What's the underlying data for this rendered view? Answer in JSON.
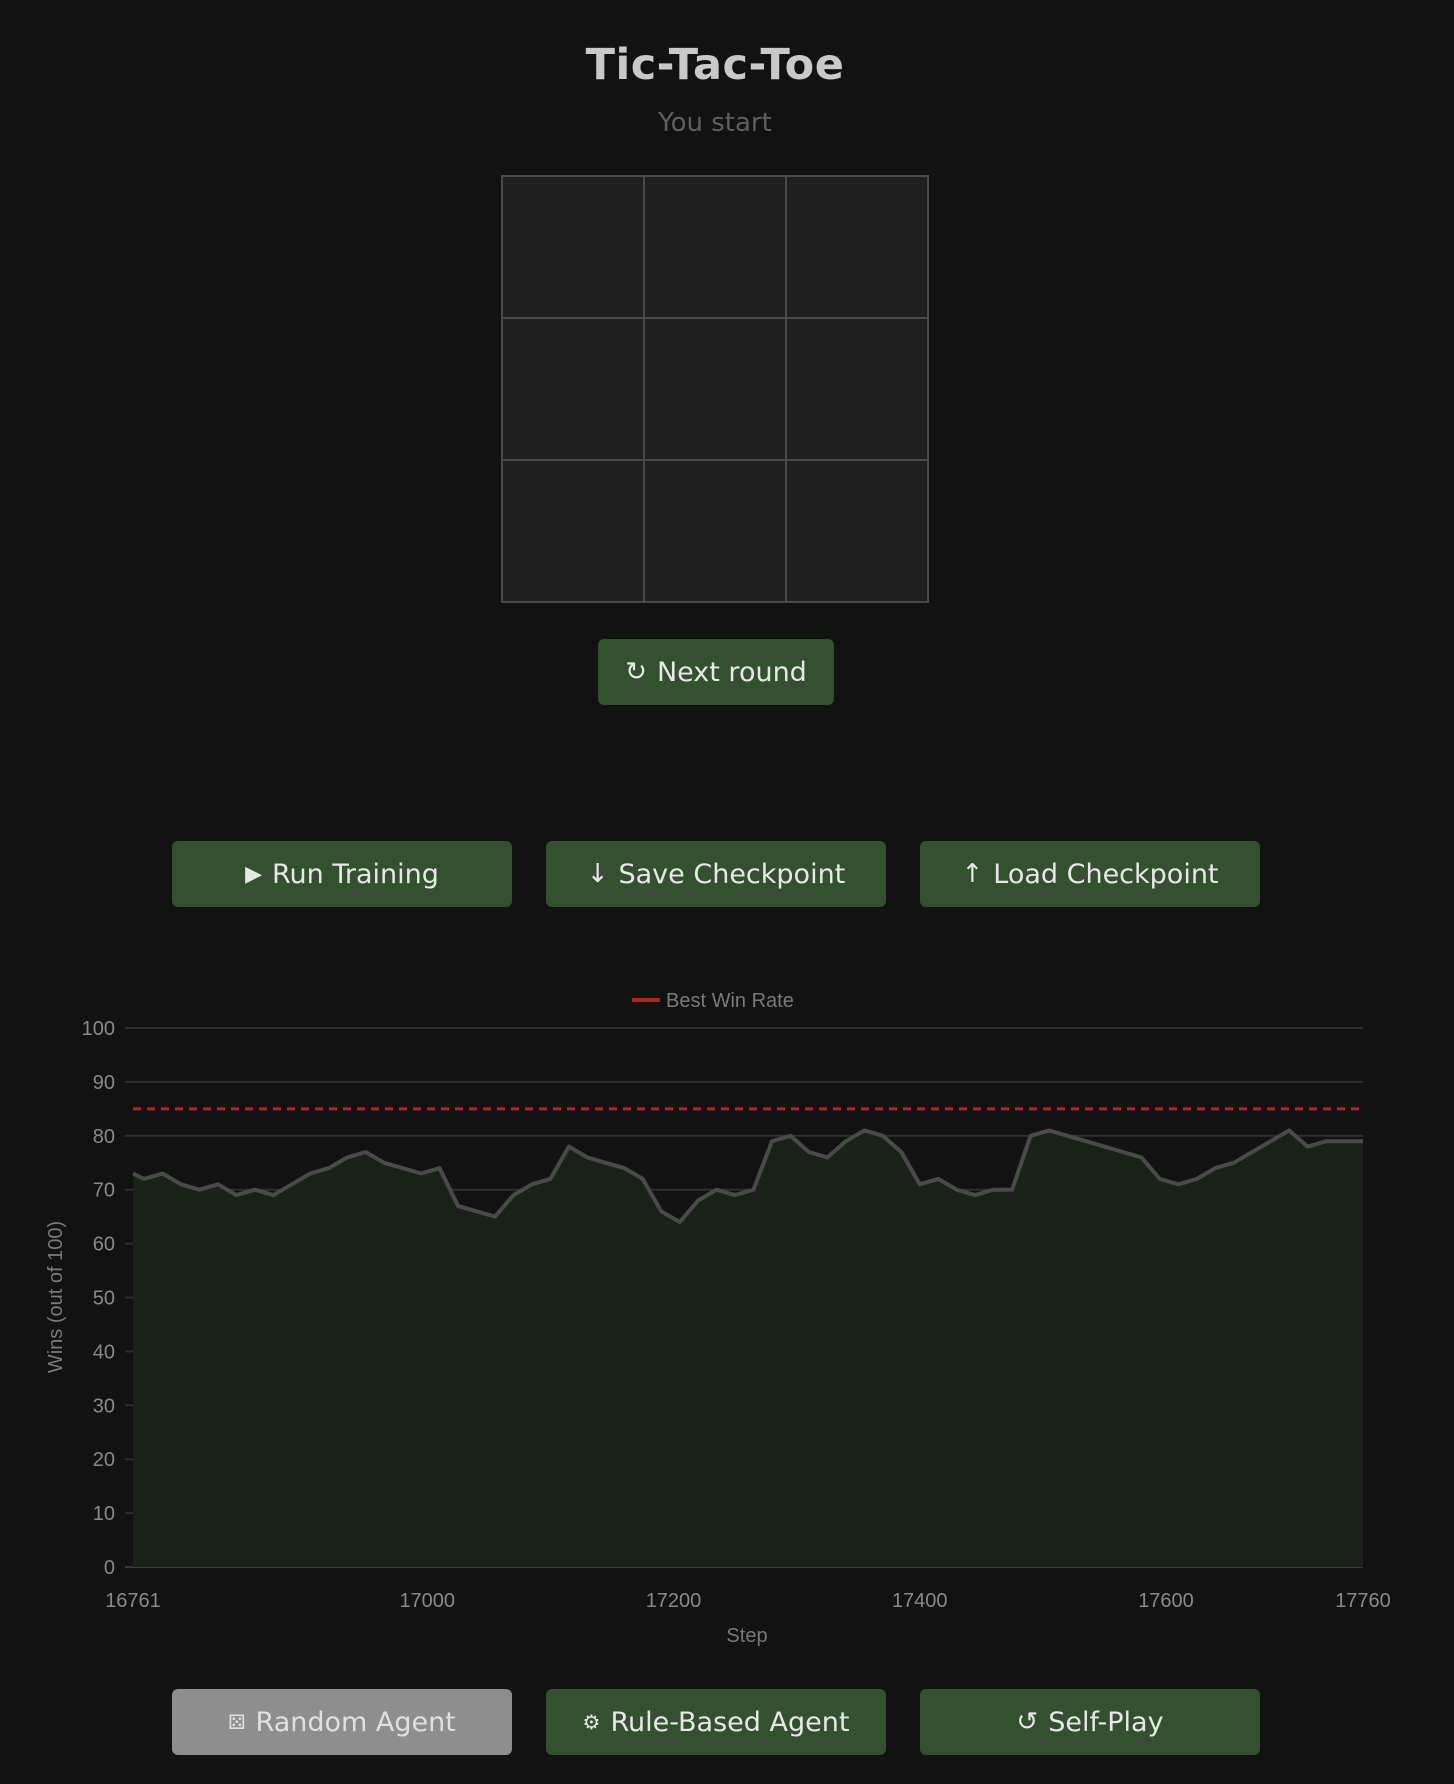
{
  "header": {
    "title": "Tic-Tac-Toe",
    "status": "You start"
  },
  "board": {
    "cells": [
      "",
      "",
      "",
      "",
      "",
      "",
      "",
      "",
      ""
    ]
  },
  "game_controls": {
    "next_round_label": "Next round",
    "next_round_icon": "refresh-icon"
  },
  "training_controls": {
    "run_training_label": "Run Training",
    "run_training_icon": "play-icon",
    "save_checkpoint_label": "Save Checkpoint",
    "save_checkpoint_icon": "arrow-down-icon",
    "load_checkpoint_label": "Load Checkpoint",
    "load_checkpoint_icon": "arrow-up-icon"
  },
  "opponent_controls": {
    "random_agent_label": "Random Agent",
    "random_agent_icon": "dice-icon",
    "rule_based_agent_label": "Rule-Based Agent",
    "rule_based_agent_icon": "gear-icon",
    "self_play_label": "Self-Play",
    "self_play_icon": "loop-icon"
  },
  "colors": {
    "button_green": "#33502f",
    "button_disabled": "#8e8e8e",
    "best_line": "#b3261e",
    "series_line": "#4a4a4a",
    "series_fill": "#1a2119"
  },
  "chart_data": {
    "type": "line",
    "xlabel": "Step",
    "ylabel": "Wins (out of 100)",
    "xlim": [
      16761,
      17760
    ],
    "ylim": [
      0,
      100
    ],
    "x_ticks": [
      16761,
      17000,
      17200,
      17400,
      17600,
      17760
    ],
    "y_ticks": [
      0,
      10,
      20,
      30,
      40,
      50,
      60,
      70,
      80,
      90,
      100
    ],
    "grid": true,
    "legend_position": "top-center",
    "legend": [
      "Best Win Rate"
    ],
    "best_win_rate": 85,
    "series": [
      {
        "x": [
          16761,
          16770,
          16785,
          16800,
          16815,
          16830,
          16845,
          16860,
          16875,
          16890,
          16905,
          16920,
          16935,
          16950,
          16965,
          16980,
          16995,
          17010,
          17025,
          17040,
          17055,
          17070,
          17085,
          17100,
          17115,
          17130,
          17145,
          17160,
          17175,
          17190,
          17205,
          17220,
          17235,
          17250,
          17265,
          17280,
          17295,
          17310,
          17325,
          17340,
          17355,
          17370,
          17385,
          17400,
          17415,
          17430,
          17445,
          17460,
          17475,
          17490,
          17505,
          17520,
          17535,
          17550,
          17565,
          17580,
          17595,
          17610,
          17625,
          17640,
          17655,
          17670,
          17685,
          17700,
          17715,
          17730,
          17745,
          17760
        ],
        "y": [
          73,
          72,
          73,
          71,
          70,
          71,
          69,
          70,
          69,
          71,
          73,
          74,
          76,
          77,
          75,
          74,
          73,
          74,
          67,
          66,
          65,
          69,
          71,
          72,
          78,
          76,
          75,
          74,
          72,
          66,
          64,
          68,
          70,
          69,
          70,
          79,
          80,
          77,
          76,
          79,
          81,
          80,
          77,
          71,
          72,
          70,
          69,
          70,
          70,
          80,
          81,
          80,
          79,
          78,
          77,
          76,
          72,
          71,
          72,
          74,
          75,
          77,
          79,
          81,
          78,
          79,
          79,
          79
        ]
      }
    ]
  }
}
